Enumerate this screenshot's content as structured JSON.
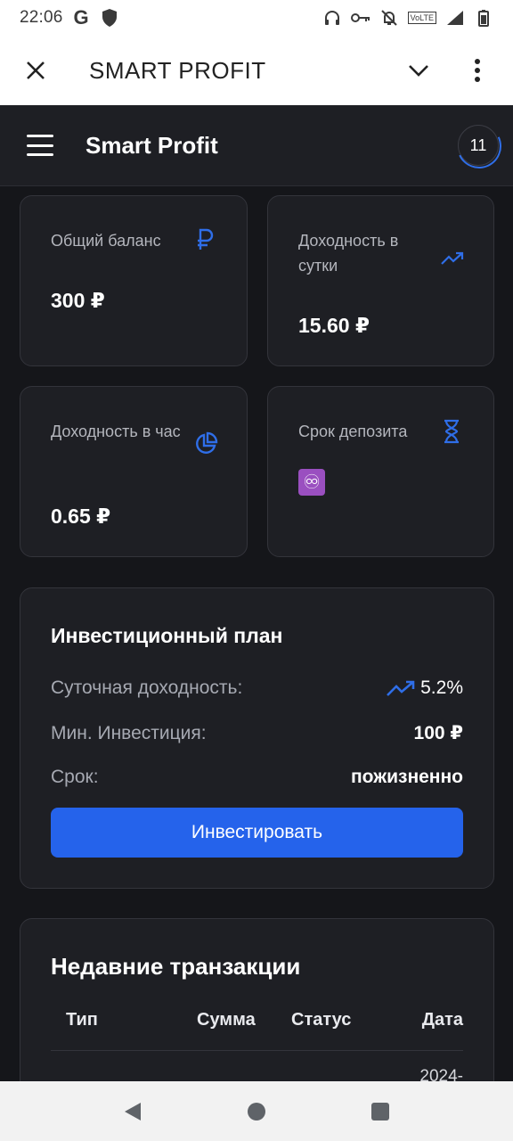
{
  "status_bar": {
    "time": "22:06",
    "network": "4G",
    "volte": "VoLTE"
  },
  "toolbar": {
    "title": "SMART PROFIT"
  },
  "app_header": {
    "brand": "Smart Profit",
    "counter": "11"
  },
  "stats": {
    "total_balance": {
      "label": "Общий баланс",
      "value": "300 ₽",
      "icon": "ruble-icon"
    },
    "daily_income": {
      "label": "Доходность в сутки",
      "value": "15.60 ₽",
      "icon": "trending-up-icon"
    },
    "hourly_income": {
      "label": "Доходность в час",
      "value": "0.65 ₽",
      "icon": "pie-chart-icon"
    },
    "deposit_term": {
      "label": "Срок депозита",
      "value": "♾",
      "icon": "hourglass-icon"
    }
  },
  "plan": {
    "title": "Инвестиционный план",
    "daily_label": "Суточная доходность:",
    "daily_value": "5.2%",
    "min_label": "Мин. Инвестиция:",
    "min_value": "100 ₽",
    "term_label": "Срок:",
    "term_value": "пожизненно",
    "button": "Инвестировать"
  },
  "transactions": {
    "title": "Недавние транзакции",
    "columns": [
      "Тип",
      "Сумма",
      "Статус",
      "Дата"
    ],
    "rows": [
      {
        "type": "",
        "amount": "",
        "status": "",
        "date": "2024-"
      }
    ]
  },
  "colors": {
    "accent": "#2563eb",
    "background": "#15161a",
    "card": "#1e1f24"
  }
}
